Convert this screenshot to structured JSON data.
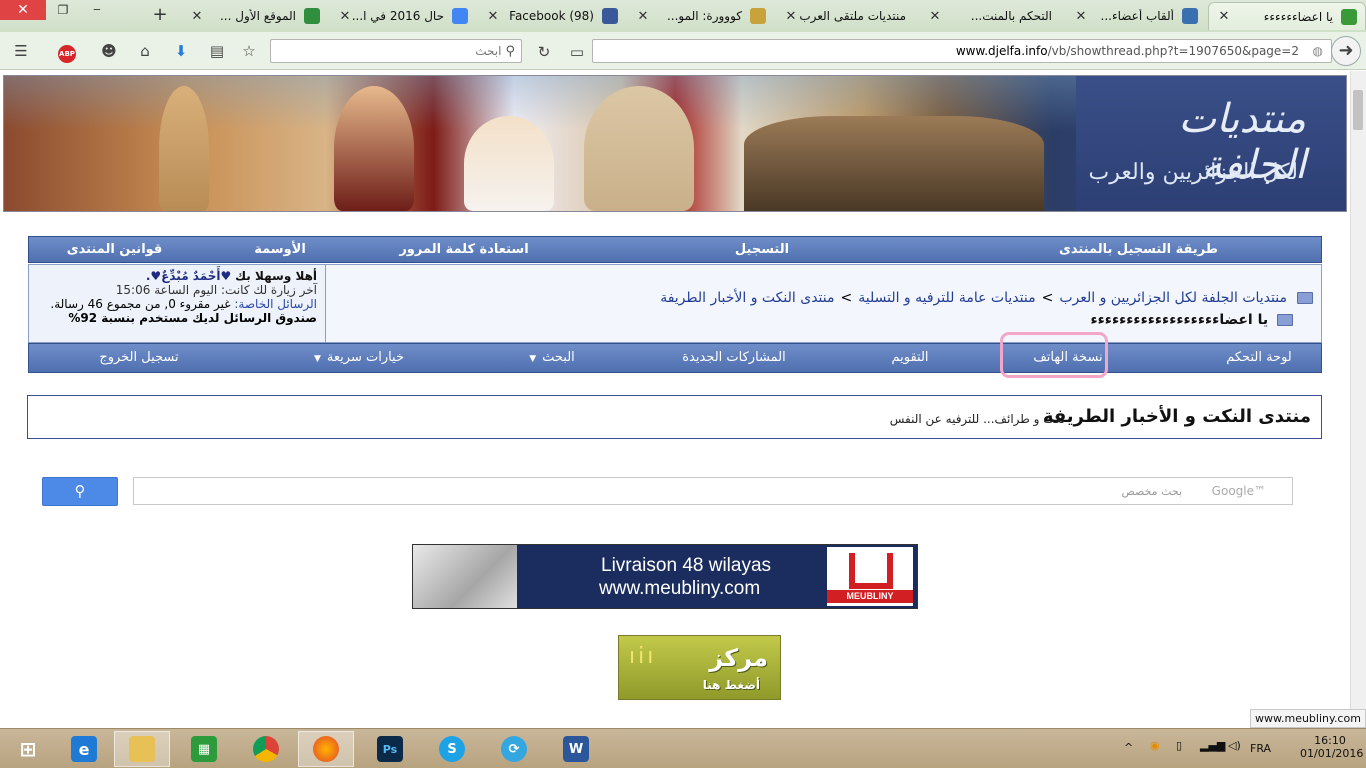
{
  "browser": {
    "tabs": [
      {
        "title": "يا اعضاءءءءءء",
        "fav_color": "#3a9a3a"
      },
      {
        "title": "ألقاب أعضاء...",
        "fav_color": "#3a6fb0"
      },
      {
        "title": "التحكم بالمنت...",
        "fav_color": ""
      },
      {
        "title": "منتديات ملتقى العرب",
        "fav_color": ""
      },
      {
        "title": "كووورة: المو...",
        "fav_color": "#c8a23a"
      },
      {
        "title": "Facebook (98)",
        "fav_color": "#3b5998"
      },
      {
        "title": "حال 2016 في ا...",
        "fav_color": "#4285f4"
      },
      {
        "title": "الموقع الأول ...",
        "fav_color": "#2f8f3f"
      }
    ],
    "new_tab_label": "+",
    "search_placeholder": "ابحث",
    "url_domain": "www.djelfa.info",
    "url_path": "/vb/showthread.php?t=1907650&page=2",
    "status_url": "www.meubliny.com"
  },
  "banner": {
    "logo_title": "منتديات الجلفة",
    "logo_subtitle": "لكل الجزائريين والعرب"
  },
  "top_nav": [
    {
      "label": "طريقة التسجيل بالمنتدى"
    },
    {
      "label": "التسجيل"
    },
    {
      "label": "استعادة كلمة المرور"
    },
    {
      "label": "الأوسمة"
    },
    {
      "label": "قوانين المنتدى"
    }
  ],
  "breadcrumb": {
    "items": [
      "منتديات الجلفة لكل الجزائريين و العرب",
      "منتديات عامة للترفيه و التسلية",
      "منتدى النكت و الأخبار الطريفة"
    ],
    "separator": ">",
    "thread_title": "يا اعضاءءءءءءءءءءءءءءءءءء"
  },
  "user": {
    "greeting": "أهلا وسهلا بك",
    "username": "♥أَحْمَدٌ مُبْدِّعٌ♥.",
    "last_visit_label": "آخر زيارة لك كانت: اليوم الساعة",
    "last_visit_time": "15:06",
    "pm_label": "الرسائل الخاصة:",
    "pm_status": "غير مقروء 0, من مجموع 46 رسالة.",
    "quota": "صندوق الرسائل لديك مستخدم بنسبة 92%"
  },
  "nav2": [
    {
      "label": "لوحة التحكم",
      "dropdown": false
    },
    {
      "label": "نسخة الهاتف",
      "dropdown": false
    },
    {
      "label": "التقويم",
      "dropdown": false
    },
    {
      "label": "المشاركات الجديدة",
      "dropdown": false
    },
    {
      "label": "البحث",
      "dropdown": true
    },
    {
      "label": "خيارات سريعة",
      "dropdown": true
    },
    {
      "label": "تسجيل الخروج",
      "dropdown": false
    }
  ],
  "forum": {
    "title": "منتدى النكت و الأخبار الطريفة",
    "description": "نكت و طرائف... للترفيه عن النفس"
  },
  "google_search": {
    "placeholder": "بحث مخصص",
    "logo": "Google™"
  },
  "ads": {
    "ad1_line1": "Livraison 48 wilayas",
    "ad1_line2": "www.meubliny.com",
    "ad1_brand": "MEUBLINY",
    "ad2_main": "مركز",
    "ad2_cta": "أضغط هنا"
  },
  "taskbar": {
    "language": "FRA",
    "time": "16:10",
    "date": "01/01/2016",
    "apps": [
      "start",
      "internet-explorer",
      "file-explorer",
      "store",
      "chrome",
      "firefox",
      "photoshop",
      "skype",
      "network-app",
      "word"
    ]
  },
  "colors": {
    "nav_blue": "#5a7bbc",
    "crumb_link": "#223d94",
    "highlight_pink": "#f2a6c8",
    "google_button": "#4d8ae8"
  }
}
